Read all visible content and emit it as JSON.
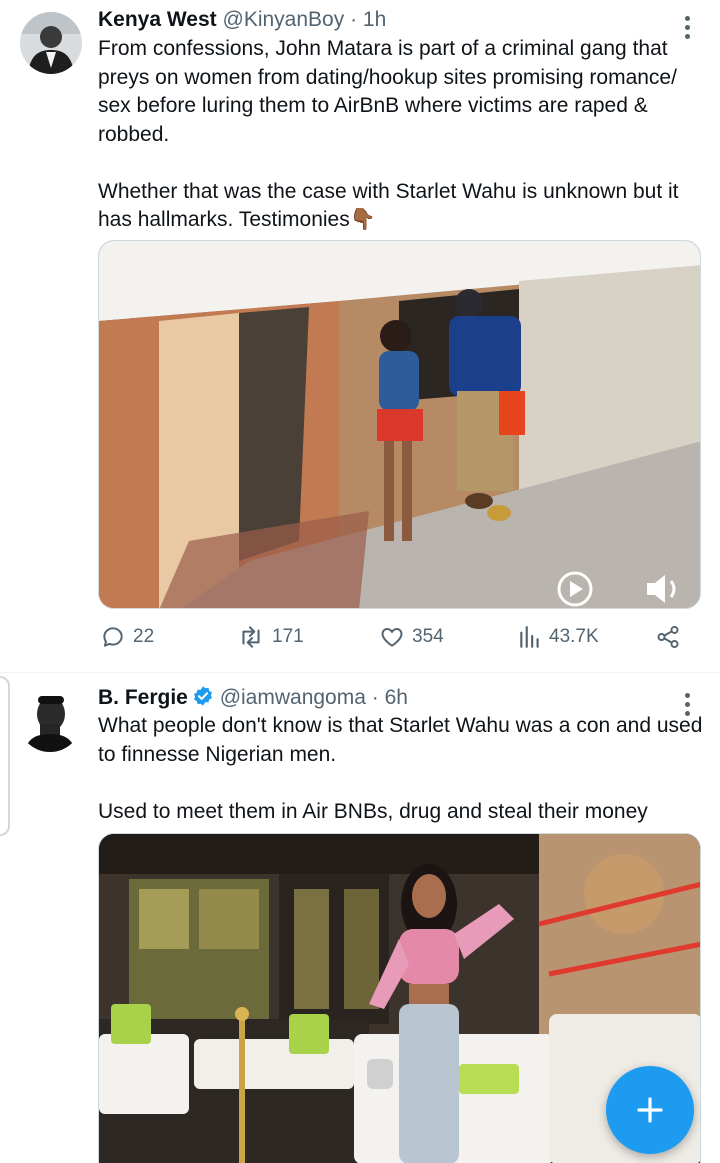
{
  "tweets": [
    {
      "author_name": "Kenya West",
      "handle": "@KinyanBoy",
      "separator": "·",
      "time": "1h",
      "text_lines": [
        "From confessions, John Matara is part of a criminal gang that preys on women from dating/hookup sites promising romance/ sex before luring them to AirBnB where victims are raped & robbed.",
        "Whether that was the case with Starlet Wahu is unknown but it has hallmarks. Testimonies👇🏾"
      ],
      "media_type": "video",
      "replies": "22",
      "retweets": "171",
      "likes": "354",
      "views": "43.7K",
      "icons": [
        "reply-icon",
        "retweet-icon",
        "like-icon",
        "views-icon",
        "share-icon"
      ]
    },
    {
      "author_name": "B. Fergie",
      "handle": "@iamwangoma",
      "separator": "·",
      "time": "6h",
      "verified": true,
      "text_lines": [
        "What people don't know is that Starlet Wahu was a con and used to finnesse Nigerian men.",
        "Used to meet them in Air BNBs, drug and steal their money"
      ],
      "media_type": "photo"
    }
  ],
  "compose_button": {
    "icon": "plus-icon"
  },
  "colors": {
    "accent": "#1d9bf0",
    "text": "#0f1419",
    "secondary": "#536471",
    "border": "#eff3f4"
  }
}
